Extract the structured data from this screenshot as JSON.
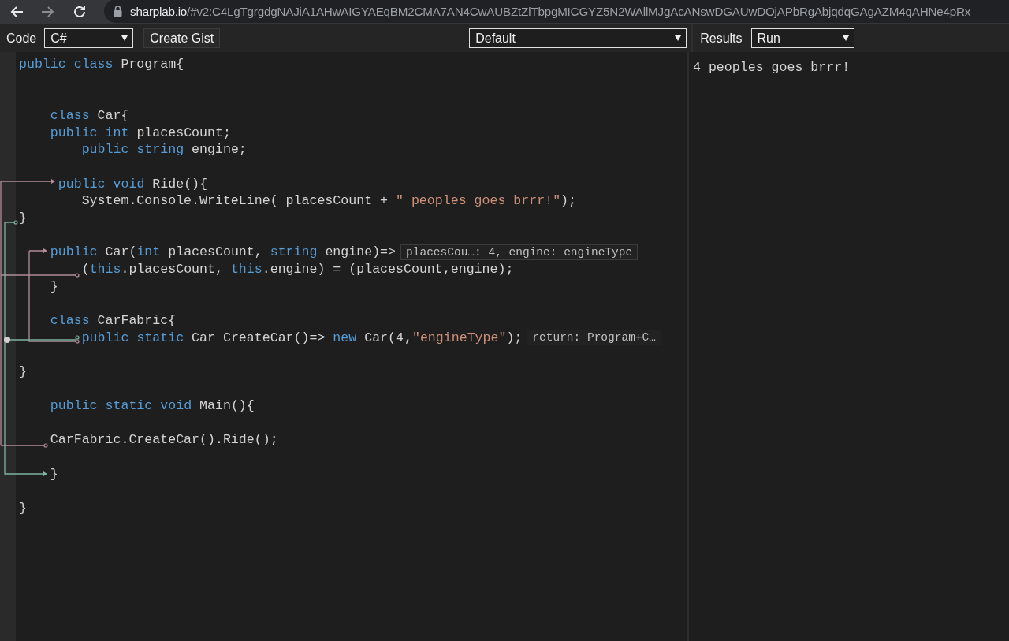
{
  "browser": {
    "url_host": "sharplab.io",
    "url_path": "/#v2:C4LgTgrgdgNAJiA1AHwAIGYAEqBM2CMA7AN4CwAUBZtZlTbpgMICGYZ5N2WAllMJgAcANswDGAUwDOjAPbRgAbjqdqGAgAZM4qAHNe4pRx"
  },
  "toolbar": {
    "code_label": "Code",
    "language_select": "C#",
    "create_gist": "Create Gist",
    "mode_select": "Default",
    "results_label": "Results",
    "results_select": "Run"
  },
  "editor": {
    "lines": [
      {
        "kind": "code",
        "tokens": [
          {
            "kind": "keyword",
            "text": "public"
          },
          {
            "kind": "keyword",
            "text": " class"
          },
          {
            "kind": "plain",
            "text": " Program{"
          }
        ]
      },
      {
        "kind": "blank"
      },
      {
        "kind": "blank"
      },
      {
        "kind": "code",
        "tokens": [
          {
            "kind": "keyword",
            "text": "    class"
          },
          {
            "kind": "plain",
            "text": " Car{"
          }
        ]
      },
      {
        "kind": "code",
        "tokens": [
          {
            "kind": "keyword",
            "text": "    public"
          },
          {
            "kind": "keyword",
            "text": " int"
          },
          {
            "kind": "plain",
            "text": " placesCount;"
          }
        ]
      },
      {
        "kind": "code",
        "tokens": [
          {
            "kind": "keyword",
            "text": "        public"
          },
          {
            "kind": "keyword",
            "text": " string"
          },
          {
            "kind": "plain",
            "text": " engine;"
          }
        ]
      },
      {
        "kind": "blank"
      },
      {
        "kind": "code",
        "tokens": [
          {
            "kind": "keyword",
            "text": "     public"
          },
          {
            "kind": "keyword",
            "text": " void"
          },
          {
            "kind": "plain",
            "text": " Ride(){"
          }
        ]
      },
      {
        "kind": "code",
        "tokens": [
          {
            "kind": "plain",
            "text": "        System.Console.WriteLine( placesCount + "
          },
          {
            "kind": "string",
            "text": "\" peoples goes brrr!\""
          },
          {
            "kind": "plain",
            "text": ");"
          }
        ]
      },
      {
        "kind": "code",
        "tokens": [
          {
            "kind": "plain",
            "text": "}"
          }
        ]
      },
      {
        "kind": "blank"
      },
      {
        "kind": "code",
        "tokens": [
          {
            "kind": "keyword",
            "text": "    public"
          },
          {
            "kind": "plain",
            "text": " Car("
          },
          {
            "kind": "keyword",
            "text": "int"
          },
          {
            "kind": "plain",
            "text": " placesCount, "
          },
          {
            "kind": "keyword",
            "text": "string"
          },
          {
            "kind": "plain",
            "text": " engine)=>"
          }
        ],
        "hint": "placesCou…: 4, engine: engineType"
      },
      {
        "kind": "code",
        "tokens": [
          {
            "kind": "plain",
            "text": "        ("
          },
          {
            "kind": "keyword",
            "text": "this"
          },
          {
            "kind": "plain",
            "text": ".placesCount, "
          },
          {
            "kind": "keyword",
            "text": "this"
          },
          {
            "kind": "plain",
            "text": ".engine) = (placesCount,engine);"
          }
        ]
      },
      {
        "kind": "code",
        "tokens": [
          {
            "kind": "plain",
            "text": "    }"
          }
        ]
      },
      {
        "kind": "blank"
      },
      {
        "kind": "code",
        "tokens": [
          {
            "kind": "keyword",
            "text": "    class"
          },
          {
            "kind": "plain",
            "text": " CarFabric{"
          }
        ]
      },
      {
        "kind": "code",
        "tokens": [
          {
            "kind": "keyword",
            "text": "        public"
          },
          {
            "kind": "keyword",
            "text": " static"
          },
          {
            "kind": "plain",
            "text": " Car CreateCar()=> "
          },
          {
            "kind": "keyword",
            "text": "new"
          },
          {
            "kind": "plain",
            "text": " Car(4",
            "caret": true
          },
          {
            "kind": "plain",
            "text": ","
          },
          {
            "kind": "string",
            "text": "\"engineType\""
          },
          {
            "kind": "plain",
            "text": ");"
          }
        ],
        "hint": "return: Program+C…"
      },
      {
        "kind": "blank"
      },
      {
        "kind": "code",
        "tokens": [
          {
            "kind": "plain",
            "text": "}"
          }
        ]
      },
      {
        "kind": "blank"
      },
      {
        "kind": "code",
        "tokens": [
          {
            "kind": "keyword",
            "text": "    public"
          },
          {
            "kind": "keyword",
            "text": " static"
          },
          {
            "kind": "keyword",
            "text": " void"
          },
          {
            "kind": "plain",
            "text": " Main(){"
          }
        ]
      },
      {
        "kind": "blank"
      },
      {
        "kind": "code",
        "tokens": [
          {
            "kind": "plain",
            "text": "    CarFabric.CreateCar().Ride();"
          }
        ]
      },
      {
        "kind": "blank"
      },
      {
        "kind": "code",
        "tokens": [
          {
            "kind": "plain",
            "text": "    }"
          }
        ]
      },
      {
        "kind": "blank"
      },
      {
        "kind": "code",
        "tokens": [
          {
            "kind": "plain",
            "text": "}"
          }
        ]
      }
    ]
  },
  "results": {
    "output": "4 peoples goes brrr!"
  }
}
